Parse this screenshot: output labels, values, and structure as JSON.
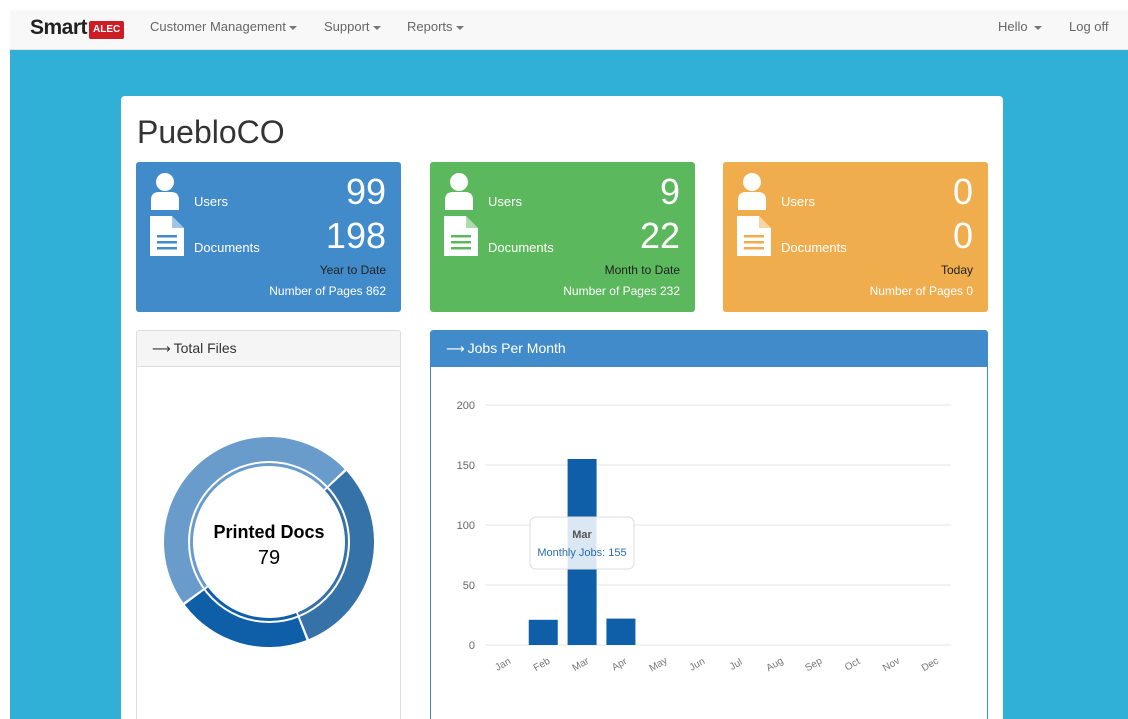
{
  "brand": {
    "name": "Smart",
    "badge": "ALEC"
  },
  "nav": {
    "items": [
      {
        "label": "Customer Management"
      },
      {
        "label": "Support"
      },
      {
        "label": "Reports"
      }
    ],
    "hello": "Hello",
    "logoff": "Log off"
  },
  "page": {
    "title": "PuebloCO"
  },
  "stats": [
    {
      "color": "#428bca",
      "users_label": "Users",
      "users": "99",
      "docs_label": "Documents",
      "docs": "198",
      "period": "Year to Date",
      "pages": "Number of Pages 862"
    },
    {
      "color": "#5cb85c",
      "users_label": "Users",
      "users": "9",
      "docs_label": "Documents",
      "docs": "22",
      "period": "Month to Date",
      "pages": "Number of Pages 232"
    },
    {
      "color": "#f0ad4e",
      "users_label": "Users",
      "users": "0",
      "docs_label": "Documents",
      "docs": "0",
      "period": "Today",
      "pages": "Number of Pages 0"
    }
  ],
  "total_files": {
    "heading": "Total Files",
    "center_label": "Printed Docs",
    "center_value": "79"
  },
  "jobs": {
    "heading": "Jobs Per Month",
    "tooltip": {
      "title": "Mar",
      "text": "Monthly Jobs: 155"
    }
  },
  "chart_data": [
    {
      "type": "pie",
      "title": "",
      "series": [
        {
          "values": [
            31,
            21,
            48
          ],
          "colors": [
            "#3572a8",
            "#0f5ea8",
            "#6a9ccb"
          ]
        }
      ]
    },
    {
      "type": "bar",
      "title": "Jobs Per Month",
      "categories": [
        "Jan",
        "Feb",
        "Mar",
        "Apr",
        "May",
        "Jun",
        "Jul",
        "Aug",
        "Sep",
        "Oct",
        "Nov",
        "Dec"
      ],
      "series": [
        {
          "name": "Monthly Jobs",
          "values": [
            0,
            21,
            155,
            22,
            0,
            0,
            0,
            0,
            0,
            0,
            0,
            0
          ]
        }
      ],
      "yticks": [
        0,
        50,
        100,
        150,
        200
      ],
      "ylim": [
        0,
        200
      ],
      "grid": true
    }
  ]
}
